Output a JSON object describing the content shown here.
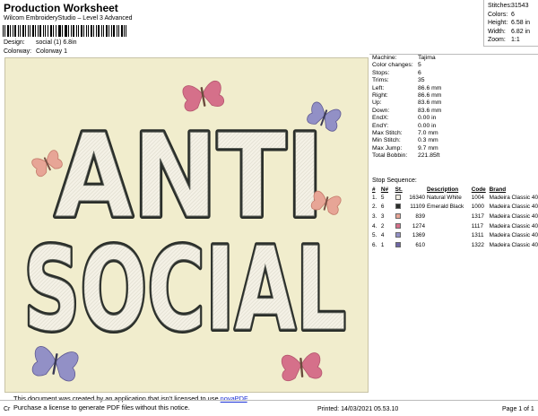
{
  "header": {
    "title": "Production Worksheet",
    "subtitle": "Wilcom EmbroideryStudio – Level 3 Advanced",
    "design_label": "Design:",
    "design_value": "social (1) 6.8in",
    "colorway_label": "Colorway:",
    "colorway_value": "Colorway 1"
  },
  "summary": [
    {
      "label": "Stitches:",
      "value": "31543"
    },
    {
      "label": "Colors:",
      "value": "6"
    },
    {
      "label": "Height:",
      "value": "6.58 in"
    },
    {
      "label": "Width:",
      "value": "6.82 in"
    },
    {
      "label": "Zoom:",
      "value": "1:1"
    }
  ],
  "stats": [
    {
      "label": "Machine:",
      "value": "Tajima"
    },
    {
      "label": "Color changes:",
      "value": "5"
    },
    {
      "label": "Stops:",
      "value": "6"
    },
    {
      "label": "Trims:",
      "value": "35"
    },
    {
      "label": "Left:",
      "value": "86.6 mm"
    },
    {
      "label": "Right:",
      "value": "86.6 mm"
    },
    {
      "label": "Up:",
      "value": "83.6 mm"
    },
    {
      "label": "Down:",
      "value": "83.6 mm"
    },
    {
      "label": "EndX:",
      "value": "0.00 in"
    },
    {
      "label": "EndY:",
      "value": "0.00 in"
    },
    {
      "label": "Max Stitch:",
      "value": "7.0 mm"
    },
    {
      "label": "Min Stitch:",
      "value": "0.3 mm"
    },
    {
      "label": "Max Jump:",
      "value": "9.7 mm"
    },
    {
      "label": "Total Bobbin:",
      "value": "221.85ft"
    }
  ],
  "stop_sequence": {
    "title": "Stop Sequence:",
    "headers": [
      "#",
      "N#",
      "St.",
      "Description",
      "Code",
      "Brand"
    ],
    "rows": [
      {
        "num": "1.",
        "n": "5",
        "color": "#f2efe4",
        "st": "16340",
        "desc": "Natural White",
        "code": "1004",
        "brand": "Madeira Classic 40"
      },
      {
        "num": "2.",
        "n": "6",
        "color": "#2a2e2a",
        "st": "11109",
        "desc": "Emerald Black",
        "code": "1000",
        "brand": "Madeira Classic 40"
      },
      {
        "num": "3.",
        "n": "3",
        "color": "#e7a596",
        "st": "839",
        "desc": "",
        "code": "1317",
        "brand": "Madeira Classic 40"
      },
      {
        "num": "4.",
        "n": "2",
        "color": "#d5708a",
        "st": "1274",
        "desc": "",
        "code": "1117",
        "brand": "Madeira Classic 40"
      },
      {
        "num": "5.",
        "n": "4",
        "color": "#9290c6",
        "st": "1369",
        "desc": "",
        "code": "1311",
        "brand": "Madeira Classic 40"
      },
      {
        "num": "6.",
        "n": "1",
        "color": "#6e66a6",
        "st": "610",
        "desc": "",
        "code": "1322",
        "brand": "Madeira Classic 40"
      }
    ]
  },
  "design": {
    "line1": "ANTI",
    "line2": "SOCIAL",
    "fabric_color": "#f1edcd",
    "fill_color": "#f2efe4",
    "outline_color": "#2a2e2a"
  },
  "footer": {
    "left": "Cr",
    "printed": "Printed: 14/03/2021 05.53.10",
    "page": "Page 1 of 1"
  },
  "notice": {
    "line1_pre": "This document was created by an application that isn't licensed to use ",
    "link": "novaPDF",
    "line1_post": ".",
    "line2": "Purchase a license to generate PDF files without this notice."
  }
}
